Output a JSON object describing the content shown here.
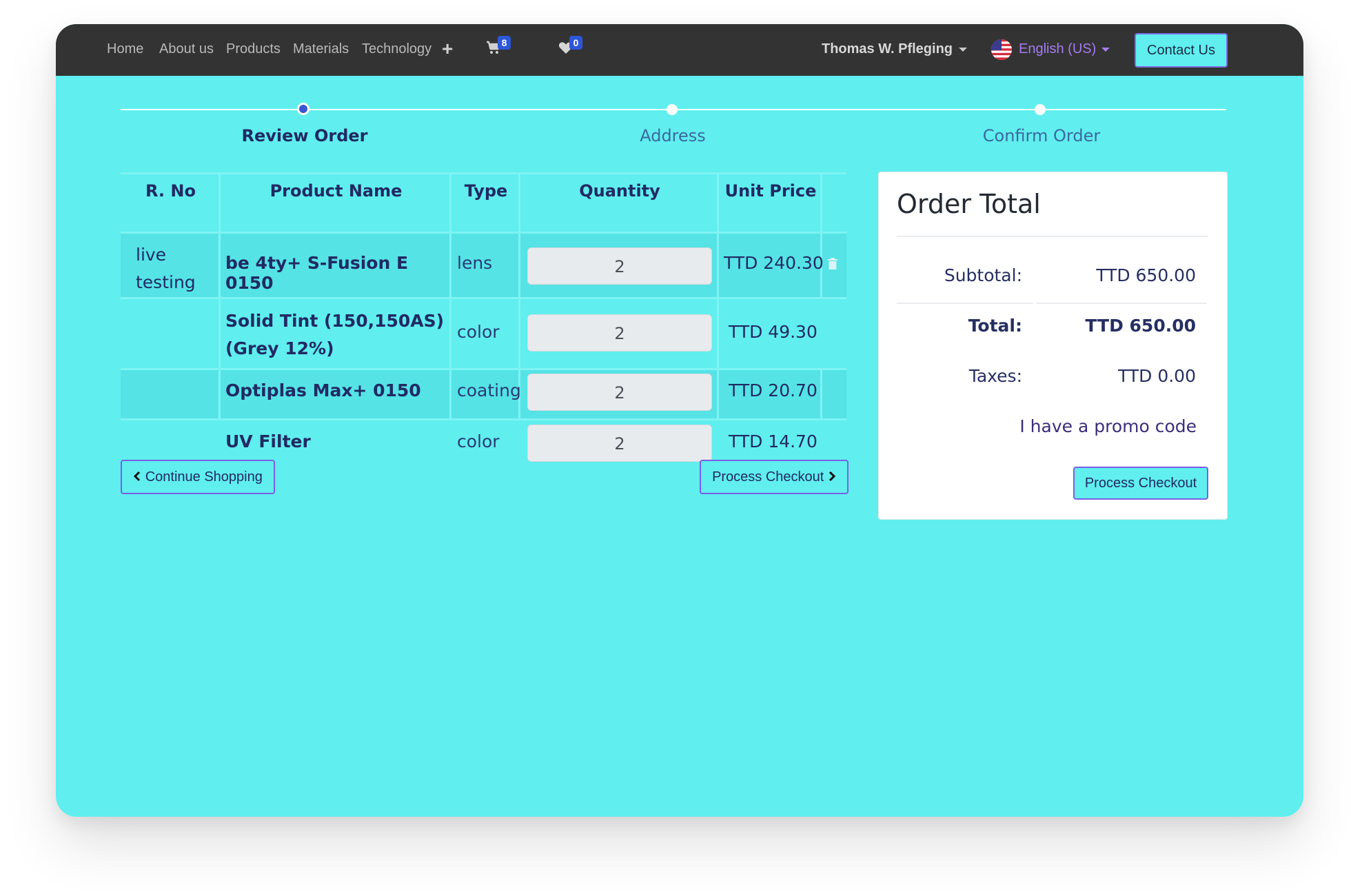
{
  "nav": {
    "links": [
      "Home",
      "About us",
      "Products",
      "Materials",
      "Technology"
    ],
    "plus_icon": "+",
    "cart_count": "8",
    "wishlist_count": "0",
    "user_name": "Thomas W. Pfleging",
    "language": "English (US)",
    "contact_label": "Contact Us"
  },
  "steps": [
    {
      "label": "Review Order",
      "active": true
    },
    {
      "label": "Address",
      "active": false
    },
    {
      "label": "Confirm Order",
      "active": false
    }
  ],
  "table": {
    "headers": [
      "R. No",
      "Product Name",
      "Type",
      "Quantity",
      "Unit Price"
    ],
    "rows": [
      {
        "rno": "live testing",
        "name": "be 4ty+ S-Fusion E 0150",
        "type": "lens",
        "qty": "2",
        "price": "TTD 240.30"
      },
      {
        "rno": "",
        "name": "Solid Tint (150,150AS) (Grey 12%)",
        "type": "color",
        "qty": "2",
        "price": "TTD 49.30"
      },
      {
        "rno": "",
        "name": "Optiplas Max+ 0150",
        "type": "coating",
        "qty": "2",
        "price": "TTD 20.70"
      },
      {
        "rno": "",
        "name": "UV Filter",
        "type": "color",
        "qty": "2",
        "price": "TTD 14.70"
      }
    ]
  },
  "buttons": {
    "continue": "Continue Shopping",
    "checkout": "Process Checkout"
  },
  "summary": {
    "title": "Order Total",
    "subtotal_label": "Subtotal:",
    "subtotal_value": "TTD 650.00",
    "total_label": "Total:",
    "total_value": "TTD 650.00",
    "taxes_label": "Taxes:",
    "taxes_value": "TTD 0.00",
    "promo_link": "I have a promo code",
    "checkout_label": "Process Checkout"
  },
  "colors": {
    "page_bg": "#60eeee",
    "nav_bg": "#333333",
    "accent": "#3a56d4",
    "text_dark": "#212a63"
  },
  "icons": [
    "plus-icon",
    "cart-icon",
    "heart-icon",
    "us-flag-icon",
    "trash-icon",
    "chevron-left-icon",
    "chevron-right-icon"
  ]
}
